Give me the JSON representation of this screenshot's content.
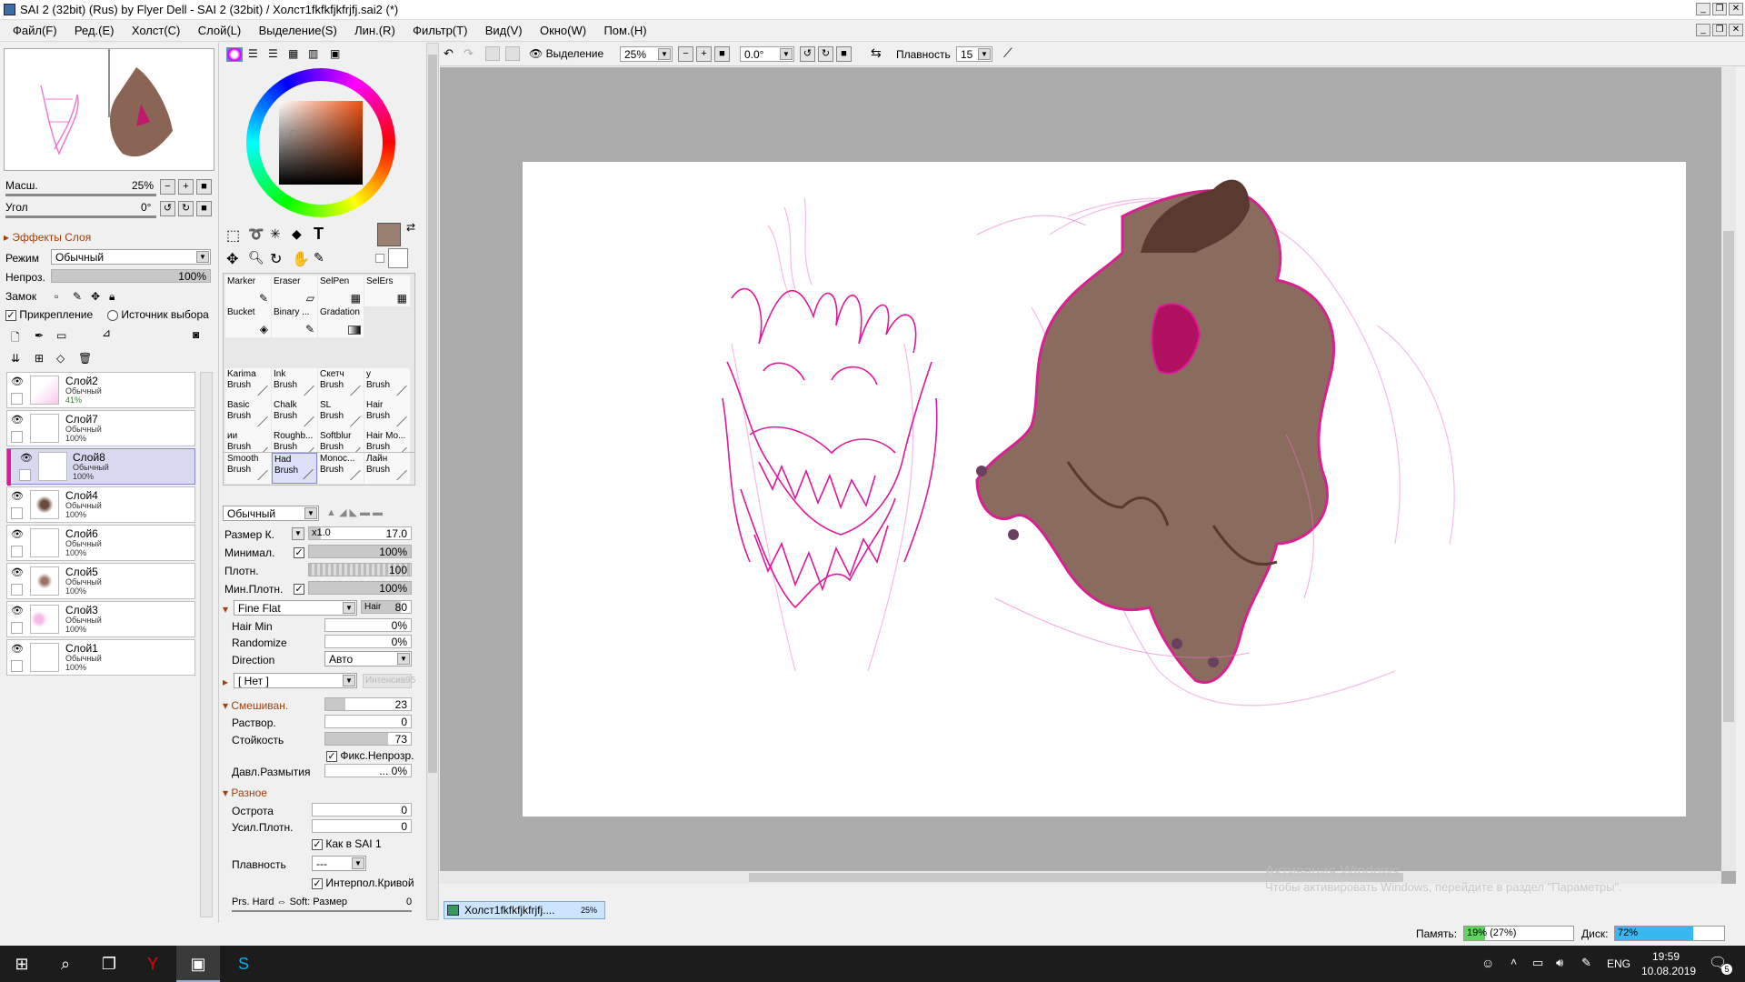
{
  "window": {
    "title": "SAI 2 (32bit) (Rus) by Flyer Dell - SAI 2 (32bit) / Холст1fkfkfjkfrjfj.sai2 (*)"
  },
  "menu": [
    "Файл(F)",
    "Ред.(E)",
    "Холст(C)",
    "Слой(L)",
    "Выделение(S)",
    "Лин.(R)",
    "Фильтр(T)",
    "Вид(V)",
    "Окно(W)",
    "Пом.(H)"
  ],
  "navigator": {
    "scale_label": "Масш.",
    "scale_value": "25%",
    "angle_label": "Угол",
    "angle_value": "0°"
  },
  "layer_effects": {
    "title": "Эффекты Слоя",
    "mode_label": "Режим",
    "mode_value": "Обычный",
    "opacity_label": "Непроз.",
    "opacity_value": "100%",
    "lock_label": "Замок",
    "clip_label": "Прикрепление",
    "source_label": "Источник выбора"
  },
  "layers": [
    {
      "name": "Слой2",
      "mode": "Обычный",
      "opacity": "41%"
    },
    {
      "name": "Слой7",
      "mode": "Обычный",
      "opacity": "100%"
    },
    {
      "name": "Слой8",
      "mode": "Обычный",
      "opacity": "100%"
    },
    {
      "name": "Слой4",
      "mode": "Обычный",
      "opacity": "100%"
    },
    {
      "name": "Слой6",
      "mode": "Обычный",
      "opacity": "100%"
    },
    {
      "name": "Слой5",
      "mode": "Обычный",
      "opacity": "100%"
    },
    {
      "name": "Слой3",
      "mode": "Обычный",
      "opacity": "100%"
    },
    {
      "name": "Слой1",
      "mode": "Обычный",
      "opacity": "100%"
    }
  ],
  "tools_top": [
    {
      "l1": "Marker",
      "l2": ""
    },
    {
      "l1": "Eraser",
      "l2": ""
    },
    {
      "l1": "SelPen",
      "l2": ""
    },
    {
      "l1": "SelErs",
      "l2": ""
    },
    {
      "l1": "Bucket",
      "l2": ""
    },
    {
      "l1": "Binary ...",
      "l2": ""
    },
    {
      "l1": "Gradation",
      "l2": ""
    }
  ],
  "brushes": [
    {
      "l1": "Karima",
      "l2": "Brush"
    },
    {
      "l1": "Ink",
      "l2": "Brush"
    },
    {
      "l1": "Скетч",
      "l2": "Brush"
    },
    {
      "l1": "у",
      "l2": "Brush"
    },
    {
      "l1": "Basic",
      "l2": "Brush"
    },
    {
      "l1": "Chalk",
      "l2": "Brush"
    },
    {
      "l1": "SL",
      "l2": "Brush"
    },
    {
      "l1": "Hair",
      "l2": "Brush"
    },
    {
      "l1": "ии",
      "l2": "Brush"
    },
    {
      "l1": "Roughb...",
      "l2": "Brush"
    },
    {
      "l1": "Softblur",
      "l2": "Brush"
    },
    {
      "l1": "Hair Mo...",
      "l2": "Brush"
    },
    {
      "l1": "Smooth",
      "l2": "Brush"
    },
    {
      "l1": "Had",
      "l2": "Brush"
    },
    {
      "l1": "Monoc...",
      "l2": "Brush"
    },
    {
      "l1": "Лайн",
      "l2": "Brush"
    }
  ],
  "brush_settings": {
    "blend_mode": "Обычный",
    "size_label": "Размер К.",
    "size_mult": "x1.0",
    "size_value": "17.0",
    "min_label": "Минимал.",
    "min_value": "100%",
    "density_label": "Плотн.",
    "density_value": "100",
    "min_density_label": "Мин.Плотн.",
    "min_density_value": "100%",
    "shape": "Fine Flat",
    "shape_tag": "Hair",
    "shape_tag_value": "80",
    "hair_min_label": "Hair Min",
    "hair_min_value": "0%",
    "randomize_label": "Randomize",
    "randomize_value": "0%",
    "direction_label": "Direction",
    "direction_value": "Авто",
    "texture": "[ Нет ]",
    "texture_intensity": "Интенсив95",
    "blend_section": "Смешиван.",
    "blend_value": "23",
    "dilution_label": "Раствор.",
    "dilution_value": "0",
    "persistence_label": "Стойкость",
    "persistence_value": "73",
    "fix_opacity_label": "Фикс.Непрозр.",
    "blur_pressure_label": "Давл.Размытия",
    "blur_pressure_value": "... 0%",
    "misc_section": "Разное",
    "sharpness_label": "Острота",
    "sharpness_value": "0",
    "density_boost_label": "Усил.Плотн.",
    "density_boost_value": "0",
    "sai1_label": "Как в SAI 1",
    "smoothness_label": "Плавность",
    "smoothness_value": "---",
    "interp_label": "Интерпол.Кривой",
    "pressure_label": "Prs. Hard ⇔ Soft: Размер",
    "pressure_value": "0"
  },
  "toolbar": {
    "selection_label": "Выделение",
    "zoom": "25%",
    "angle": "0.0°",
    "smoothing_label": "Плавность",
    "smoothing_value": "15"
  },
  "canvas_tab": {
    "name": "Холст1fkfkfjkfrjfj....",
    "zoom": "25%"
  },
  "watermark": {
    "line1": "Активация Windows",
    "line2": "Чтобы активировать Windows, перейдите в раздел \"Параметры\"."
  },
  "status": {
    "memory_label": "Память:",
    "memory_value": "19% (27%)",
    "memory_fill": 0.19,
    "disk_label": "Диск:",
    "disk_value": "72%",
    "disk_fill": 0.72
  },
  "taskbar": {
    "lang": "ENG",
    "time": "19:59",
    "date": "10.08.2019",
    "notify_count": "5"
  },
  "colors": {
    "main_color": "#9a8070",
    "accent_pink": "#e0189a",
    "selected_layer": "#d8d8f0",
    "memory_bar": "#5cd65c",
    "disk_bar": "#38b8f0"
  }
}
